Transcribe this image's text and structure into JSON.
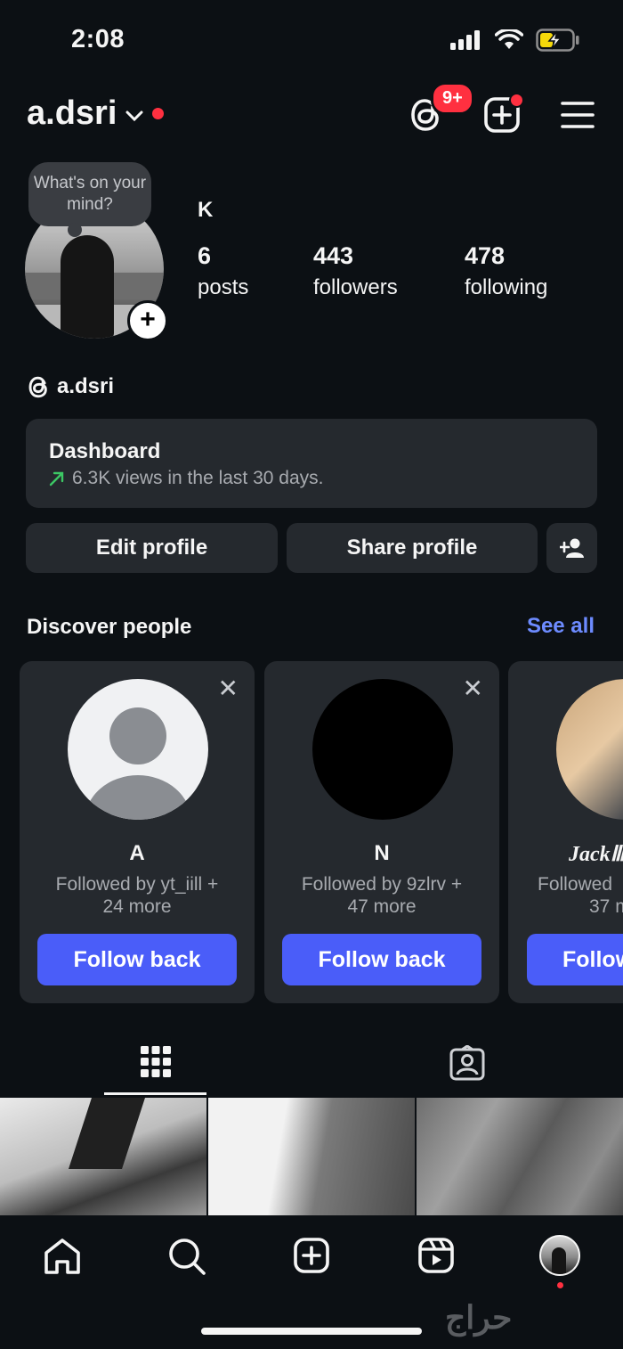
{
  "status_bar": {
    "time": "2:08"
  },
  "header": {
    "username": "a.dsri",
    "threads_badge": "9+"
  },
  "profile": {
    "note_text": "What's on your mind?",
    "display_name": "K",
    "stats": {
      "posts": {
        "value": "6",
        "label": "posts"
      },
      "followers": {
        "value": "443",
        "label": "followers"
      },
      "following": {
        "value": "478",
        "label": "following"
      }
    },
    "threads_handle": "a.dsri"
  },
  "dashboard": {
    "title": "Dashboard",
    "subtitle": "6.3K views in the last 30 days.",
    "trend_color": "#3cc864"
  },
  "actions": {
    "edit_profile": "Edit profile",
    "share_profile": "Share profile"
  },
  "discover": {
    "title": "Discover people",
    "see_all": "See all",
    "cards": [
      {
        "name": "A",
        "followed_by": "Followed by yt_iill +",
        "more": "24 more",
        "button": "Follow back"
      },
      {
        "name": "N",
        "followed_by": "Followed by 9zlrv +",
        "more": "47 more",
        "button": "Follow back"
      },
      {
        "name": "JackⅢ",
        "followed_by": "Followed",
        "more": "37 m",
        "button": "Follow"
      }
    ]
  },
  "watermark": "حراج",
  "colors": {
    "accent": "#4a5df9",
    "link": "#6d8bff",
    "notification": "#ff3040",
    "background": "#0c1014",
    "card": "#25292e"
  }
}
